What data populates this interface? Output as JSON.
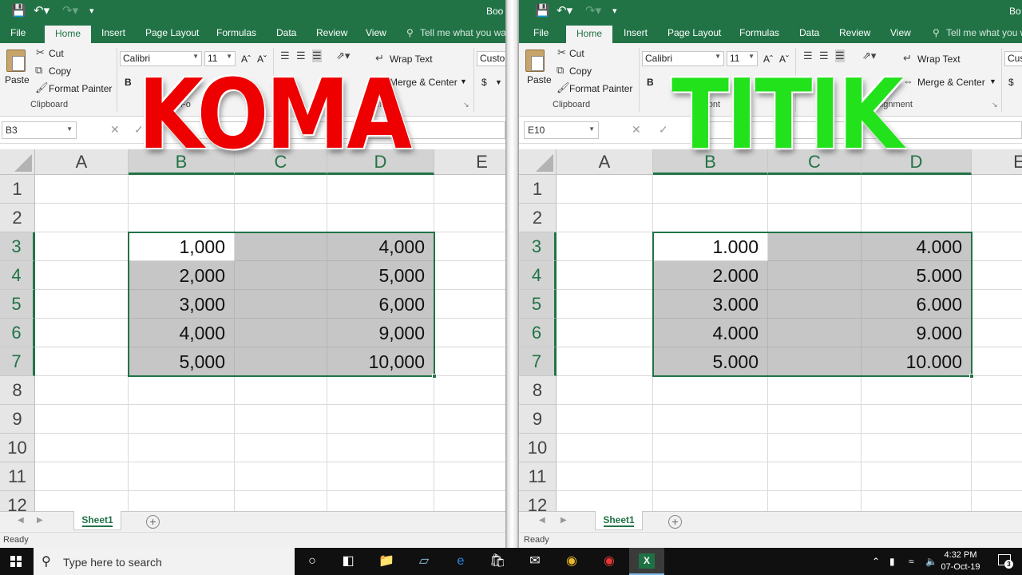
{
  "left": {
    "title": "Boo",
    "tabs": [
      "File",
      "Home",
      "Insert",
      "Page Layout",
      "Formulas",
      "Data",
      "Review",
      "View"
    ],
    "tell_me": "Tell me what you wa",
    "ribbon": {
      "paste": "Paste",
      "cut": "Cut",
      "copy": "Copy",
      "format_painter": "Format Painter",
      "clipboard": "Clipboard",
      "font_name": "Calibri",
      "font_size": "11",
      "font_group": "Fo",
      "wrap_text": "Wrap Text",
      "merge_center": "Merge & Center",
      "alignment": "lignment",
      "number_format": "Custor",
      "currency": "$",
      "bold": "B",
      "italic": "I"
    },
    "name_box": "B3",
    "columns": [
      "A",
      "B",
      "C",
      "D",
      "E"
    ],
    "rows": [
      "1",
      "2",
      "3",
      "4",
      "5",
      "6",
      "7",
      "8",
      "9",
      "10",
      "11",
      "12"
    ],
    "b_values": [
      "1,000",
      "2,000",
      "3,000",
      "4,000",
      "5,000"
    ],
    "d_values": [
      "4,000",
      "5,000",
      "6,000",
      "9,000",
      "10,000"
    ],
    "sheet": "Sheet1",
    "status": "Ready",
    "overlay": "KOMA"
  },
  "right": {
    "title": "Bo",
    "tabs": [
      "File",
      "Home",
      "Insert",
      "Page Layout",
      "Formulas",
      "Data",
      "Review",
      "View"
    ],
    "tell_me": "Tell me what you wa",
    "ribbon": {
      "paste": "Paste",
      "cut": "Cut",
      "copy": "Copy",
      "format_painter": "Format Painter",
      "clipboard": "Clipboard",
      "font_name": "Calibri",
      "font_size": "11",
      "font_group": "Font",
      "wrap_text": "Wrap Text",
      "merge_center": "Merge & Center",
      "alignment": "Alignment",
      "number_format": "Cus",
      "currency": "$",
      "bold": "B",
      "italic": "I"
    },
    "name_box": "E10",
    "columns": [
      "A",
      "B",
      "C",
      "D",
      "E"
    ],
    "rows": [
      "1",
      "2",
      "3",
      "4",
      "5",
      "6",
      "7",
      "8",
      "9",
      "10",
      "11",
      "12"
    ],
    "b_values": [
      "1.000",
      "2.000",
      "3.000",
      "4.000",
      "5.000"
    ],
    "d_values": [
      "4.000",
      "5.000",
      "6.000",
      "9.000",
      "10.000"
    ],
    "sheet": "Sheet1",
    "status": "Ready",
    "overlay": "TITIK"
  },
  "taskbar": {
    "search_placeholder": "Type here to search",
    "time": "4:32 PM",
    "date": "07-Oct-19",
    "notification_count": "3",
    "excel_letter": "X"
  },
  "colors": {
    "excel_green": "#217346",
    "koma_red": "#ee0000",
    "titik_green": "#22e21b",
    "selection_gray": "#c6c6c6"
  }
}
